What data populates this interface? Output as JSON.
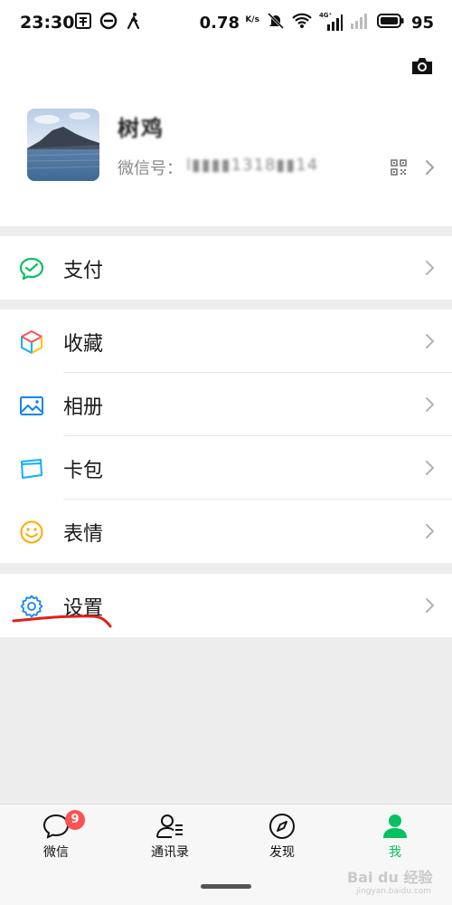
{
  "status_bar": {
    "time": "23:30",
    "net_speed": "0.78",
    "net_speed_unit": "K/s",
    "signal_label": "4G⁺",
    "battery": "95"
  },
  "profile": {
    "nickname": "树鸡",
    "wechat_id_label": "微信号：",
    "wechat_id_value": "l▮▮▮▮1318▮▮14"
  },
  "menu": {
    "pay": "支付",
    "favorites": "收藏",
    "album": "相册",
    "cards": "卡包",
    "stickers": "表情",
    "settings": "设置"
  },
  "tabbar": {
    "chats": "微信",
    "chats_badge": "9",
    "contacts": "通讯录",
    "discover": "发现",
    "me": "我"
  },
  "colors": {
    "accent": "#07c160",
    "badge": "#fa5151",
    "annotation": "#e0201a"
  },
  "icons": [
    "camera-icon",
    "qr-code-icon",
    "pay-icon",
    "favorites-icon",
    "album-icon",
    "cards-icon",
    "stickers-icon",
    "settings-icon",
    "chats-icon",
    "contacts-icon",
    "discover-icon",
    "me-icon"
  ],
  "watermark": {
    "text": "Bai du 经验",
    "sub": "jingyan.baidu.com"
  }
}
